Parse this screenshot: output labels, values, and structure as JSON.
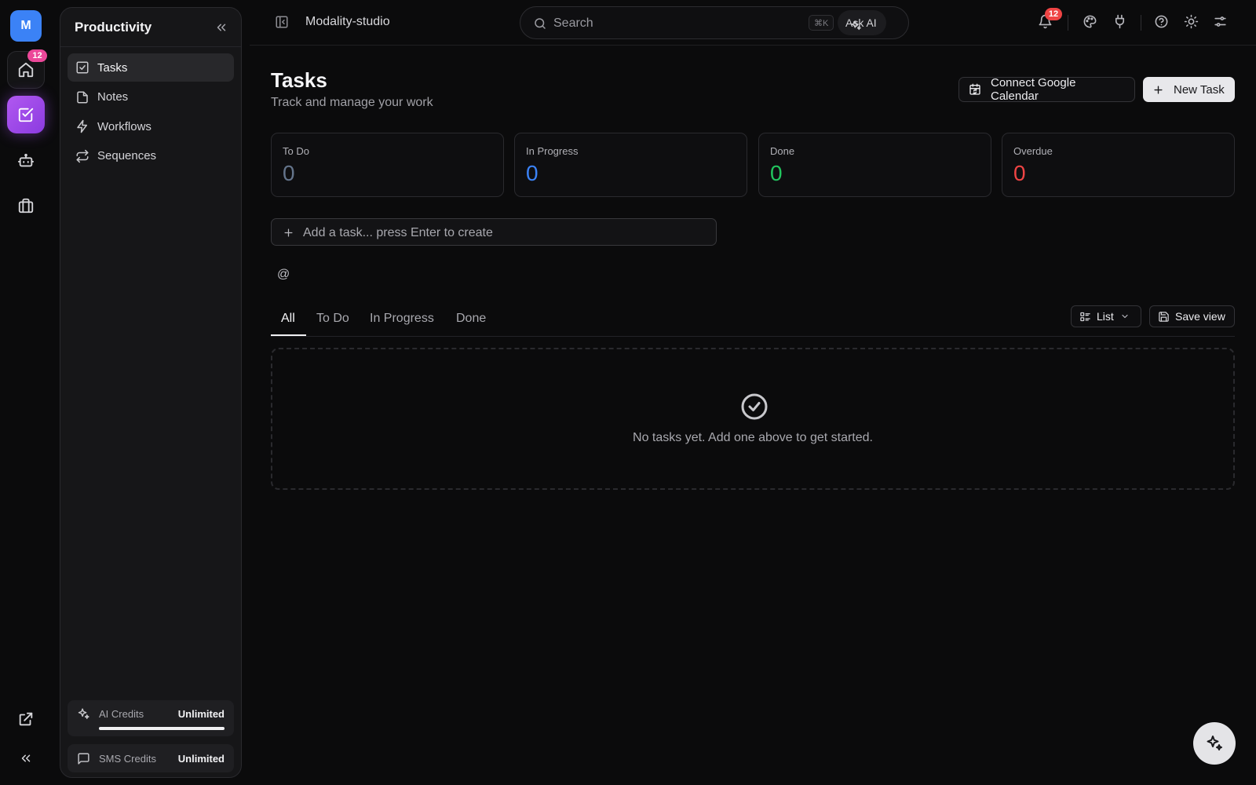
{
  "rail": {
    "avatar_letter": "M",
    "home_badge": "12"
  },
  "sidebar": {
    "title": "Productivity",
    "items": [
      {
        "label": "Tasks",
        "icon": "checkbox-icon",
        "active": true
      },
      {
        "label": "Notes",
        "icon": "file-icon",
        "active": false
      },
      {
        "label": "Workflows",
        "icon": "bolt-icon",
        "active": false
      },
      {
        "label": "Sequences",
        "icon": "repeat-icon",
        "active": false
      }
    ],
    "credits": {
      "ai_label": "AI Credits",
      "ai_value": "Unlimited",
      "ai_level": 1.0,
      "sms_label": "SMS Credits",
      "sms_value": "Unlimited"
    }
  },
  "topbar": {
    "workspace": "Modality-studio",
    "search_placeholder": "Search",
    "shortcut": "⌘K",
    "ask_ai": "Ask AI",
    "notification_count": "12"
  },
  "header": {
    "title": "Tasks",
    "subtitle": "Track and manage your work",
    "connect_calendar": "Connect Google Calendar",
    "new_task": "New Task"
  },
  "stats": [
    {
      "label": "To Do",
      "value": "0",
      "color": "#64748b"
    },
    {
      "label": "In Progress",
      "value": "0",
      "color": "#3b82f6"
    },
    {
      "label": "Done",
      "value": "0",
      "color": "#22c55e"
    },
    {
      "label": "Overdue",
      "value": "0",
      "color": "#ef4444"
    }
  ],
  "quick_add": {
    "placeholder": "Add a task... press Enter to create",
    "mention": "@"
  },
  "tabs": [
    {
      "label": "All",
      "active": true
    },
    {
      "label": "To Do",
      "active": false
    },
    {
      "label": "In Progress",
      "active": false
    },
    {
      "label": "Done",
      "active": false
    }
  ],
  "view": {
    "layout_label": "List",
    "save_view": "Save view"
  },
  "empty_state": {
    "message": "No tasks yet. Add one above to get started."
  },
  "colors": {
    "accent": "#a855f7",
    "avatar": "#3b82f6",
    "badge": "#ec4899",
    "notification": "#ef4444"
  }
}
